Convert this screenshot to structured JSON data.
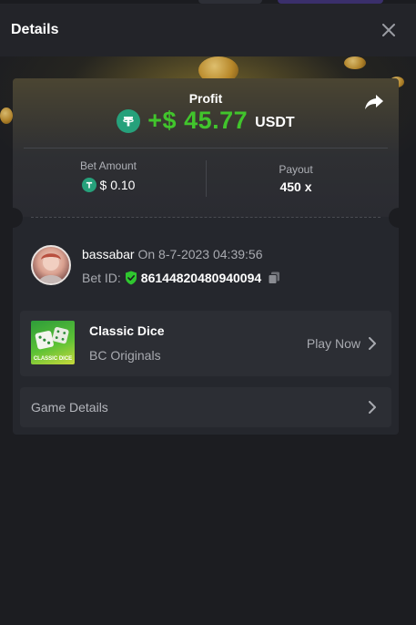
{
  "header": {
    "title": "Details",
    "close_icon": "close-icon"
  },
  "profit": {
    "label": "Profit",
    "amount": "+$ 45.77",
    "currency": "USDT",
    "share_icon": "share-icon",
    "token_icon": "tether-icon"
  },
  "stats": {
    "bet_amount_label": "Bet Amount",
    "bet_amount_value": "$ 0.10",
    "payout_label": "Payout",
    "payout_value": "450 x"
  },
  "user": {
    "name": "bassabar",
    "date_text": "On 8-7-2023 04:39:56",
    "bet_id_label": "Bet ID:",
    "bet_id_value": "86144820480940094",
    "verified_icon": "shield-check-icon",
    "copy_icon": "copy-icon"
  },
  "game": {
    "name": "Classic Dice",
    "provider": "BC Originals",
    "thumb_text": "CLASSIC DICE",
    "play_label": "Play Now"
  },
  "details": {
    "label": "Game Details"
  },
  "colors": {
    "profit_green": "#41c52c",
    "tether_green": "#26a17b",
    "background": "#1c1d21",
    "card": "#25272d"
  }
}
